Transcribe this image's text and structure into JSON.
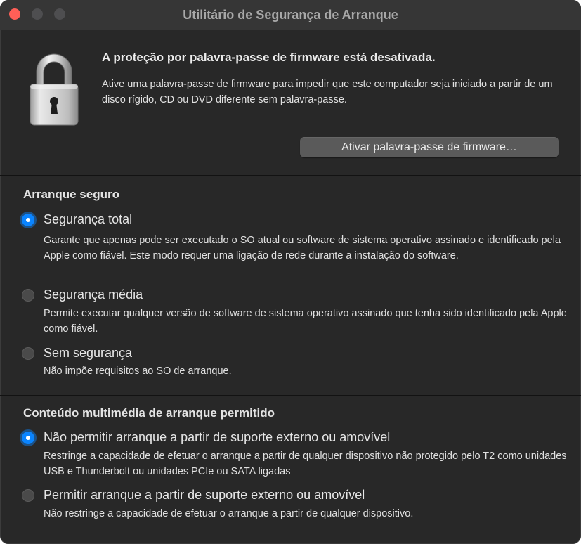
{
  "window": {
    "title": "Utilitário de Segurança de Arranque"
  },
  "firmware": {
    "heading": "A proteção por palavra-passe de firmware está desativada.",
    "description": "Ative uma palavra-passe de firmware para impedir que este computador seja iniciado a partir de um disco rígido, CD ou DVD diferente sem palavra-passe.",
    "button_label": "Ativar palavra-passe de firmware…",
    "icon": "lock-icon"
  },
  "secure_boot": {
    "title": "Arranque seguro",
    "options": [
      {
        "label": "Segurança total",
        "description": "Garante que apenas pode ser executado o SO atual ou software de sistema operativo assinado e identificado pela Apple como fiável. Este modo requer uma ligação de rede durante a instalação do software.",
        "selected": true
      },
      {
        "label": "Segurança média",
        "description": "Permite executar qualquer versão de software de sistema operativo assinado que tenha sido identificado pela Apple como fiável.",
        "selected": false
      },
      {
        "label": "Sem segurança",
        "description": "Não impõe requisitos ao SO de arranque.",
        "selected": false
      }
    ]
  },
  "external_boot": {
    "title": "Conteúdo multimédia de arranque permitido",
    "options": [
      {
        "label": "Não permitir arranque a partir de suporte externo ou amovível",
        "description": "Restringe a capacidade de efetuar o arranque a partir de qualquer dispositivo não protegido pelo T2 como unidades USB e Thunderbolt ou unidades PCIe ou SATA ligadas",
        "selected": true
      },
      {
        "label": "Permitir arranque a partir de suporte externo ou amovível",
        "description": "Não restringe a capacidade de efetuar o arranque a partir de qualquer dispositivo.",
        "selected": false
      }
    ]
  },
  "colors": {
    "accent": "#0a84ff",
    "window_bg": "#282828",
    "close_button": "#fe5f57"
  }
}
